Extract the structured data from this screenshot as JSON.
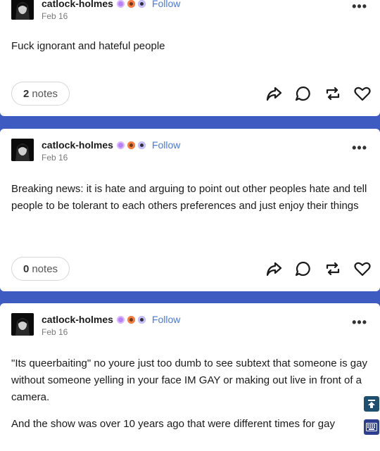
{
  "colors": {
    "page_background": "#3e5bc2",
    "follow_link": "#4a78d9"
  },
  "posts": [
    {
      "blog_name": "catlock-holmes",
      "follow": "Follow",
      "date": "Feb 16",
      "more_icon": "ellipsis-icon",
      "paragraphs": [
        "Fuck ignorant and hateful people"
      ],
      "notes_count": "2",
      "notes_label": "notes"
    },
    {
      "blog_name": "catlock-holmes",
      "follow": "Follow",
      "date": "Feb 16",
      "more_icon": "ellipsis-icon",
      "paragraphs": [
        "Breaking news: it is hate and arguing to point out other peoples hate and tell people to be tolerant to each others preferences and just enjoy their things"
      ],
      "notes_count": "0",
      "notes_label": "notes"
    },
    {
      "blog_name": "catlock-holmes",
      "follow": "Follow",
      "date": "Feb 16",
      "more_icon": "ellipsis-icon",
      "paragraphs": [
        "\"Its queerbaiting\" no youre just too dumb to see subtext that someone is gay without someone yelling in your face IM GAY or making out live in front of a camera.",
        "And the show was over 10 years ago that were different times for gay"
      ]
    }
  ],
  "actions": [
    "share-icon",
    "reply-icon",
    "reblog-icon",
    "like-icon"
  ],
  "floating": [
    "scroll-to-top-icon",
    "keyboard-icon"
  ]
}
